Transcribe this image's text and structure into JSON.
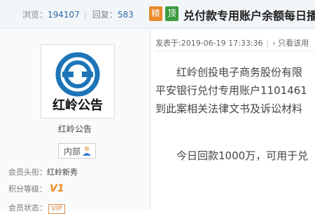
{
  "stats": {
    "views_label": "浏览：",
    "views": "194107",
    "replies_label": "回复：",
    "replies": "583"
  },
  "badges": {
    "jing": "精",
    "ding": "顶"
  },
  "thread": {
    "title": "兑付款专用账户余额每日播"
  },
  "author": {
    "logo_text": "红岭公告",
    "name": "红岭公告",
    "role": "内部",
    "member_title_label": "会员头衔：",
    "member_title": "红岭新秀",
    "level_label": "积分等级：",
    "level": "V1",
    "status_label": "会员状态：",
    "status": "VIP"
  },
  "post": {
    "posted_at": "发表于:2019-06-19 17:33:36",
    "view_only": "只看该用",
    "lines": [
      "红岭创投电子商务股份有限",
      "平安银行兑付专用账户1101461",
      "到此案相关法律文书及诉讼材料",
      "今日回款1000万，可用于兑"
    ]
  },
  "colors": {
    "accent": "#2b6aa6",
    "logo_blue": "#1c75b8",
    "jing_badge": "#e98a2b",
    "ding_badge": "#3c9b3f"
  }
}
